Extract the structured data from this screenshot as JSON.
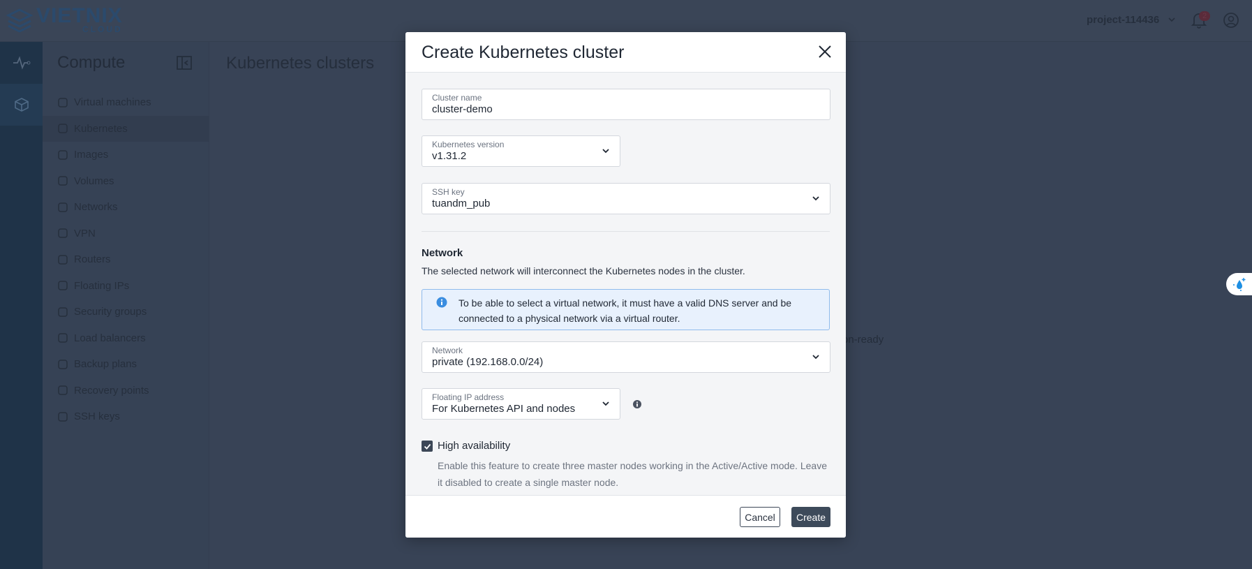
{
  "header": {
    "logo_text": "VIETNIX",
    "logo_sub": "CLOUD",
    "project": "project-114436",
    "notification_count": "2"
  },
  "rail": {
    "items": [
      {
        "icon": "activity-icon"
      },
      {
        "icon": "cube-icon",
        "active": true
      }
    ]
  },
  "sidebar": {
    "title": "Compute",
    "items": [
      {
        "label": "Virtual machines",
        "icon": "cube-icon"
      },
      {
        "label": "Kubernetes",
        "icon": "kubernetes-icon",
        "active": true
      },
      {
        "label": "Images",
        "icon": "disc-icon"
      },
      {
        "label": "Volumes",
        "icon": "drive-icon"
      },
      {
        "label": "Networks",
        "icon": "network-icon"
      },
      {
        "label": "VPN",
        "icon": "shield-icon"
      },
      {
        "label": "Routers",
        "icon": "router-icon"
      },
      {
        "label": "Floating IPs",
        "icon": "ip-icon"
      },
      {
        "label": "Security groups",
        "icon": "lock-icon"
      },
      {
        "label": "Load balancers",
        "icon": "sitemap-icon"
      },
      {
        "label": "Backup plans",
        "icon": "copy-icon"
      },
      {
        "label": "Recovery points",
        "icon": "restore-icon"
      },
      {
        "label": "SSH keys",
        "icon": "key-icon"
      }
    ]
  },
  "main": {
    "title": "Kubernetes clusters",
    "partial_text": "on-ready"
  },
  "modal": {
    "title": "Create Kubernetes cluster",
    "cluster_name": {
      "label": "Cluster name",
      "value": "cluster-demo"
    },
    "k8s_version": {
      "label": "Kubernetes version",
      "value": "v1.31.2"
    },
    "ssh_key": {
      "label": "SSH key",
      "value": "tuandm_pub"
    },
    "network_section": {
      "heading": "Network",
      "description": "The selected network will interconnect the Kubernetes nodes in the cluster.",
      "info": "To be able to select a virtual network, it must have a valid DNS server and be connected to a physical network via a virtual router."
    },
    "network": {
      "label": "Network",
      "value": "private (192.168.0.0/24)"
    },
    "floating_ip": {
      "label": "Floating IP address",
      "value": "For Kubernetes API and nodes"
    },
    "high_availability": {
      "label": "High availability",
      "checked": true,
      "help": "Enable this feature to create three master nodes working in the Active/Active mode. Leave it disabled to create a single master node."
    },
    "cancel_label": "Cancel",
    "create_label": "Create"
  },
  "colors": {
    "primary_button": "#3d4a5a",
    "info_bg": "#e8f1fd",
    "info_icon": "#3a8de0",
    "rail": "#1f3348"
  }
}
